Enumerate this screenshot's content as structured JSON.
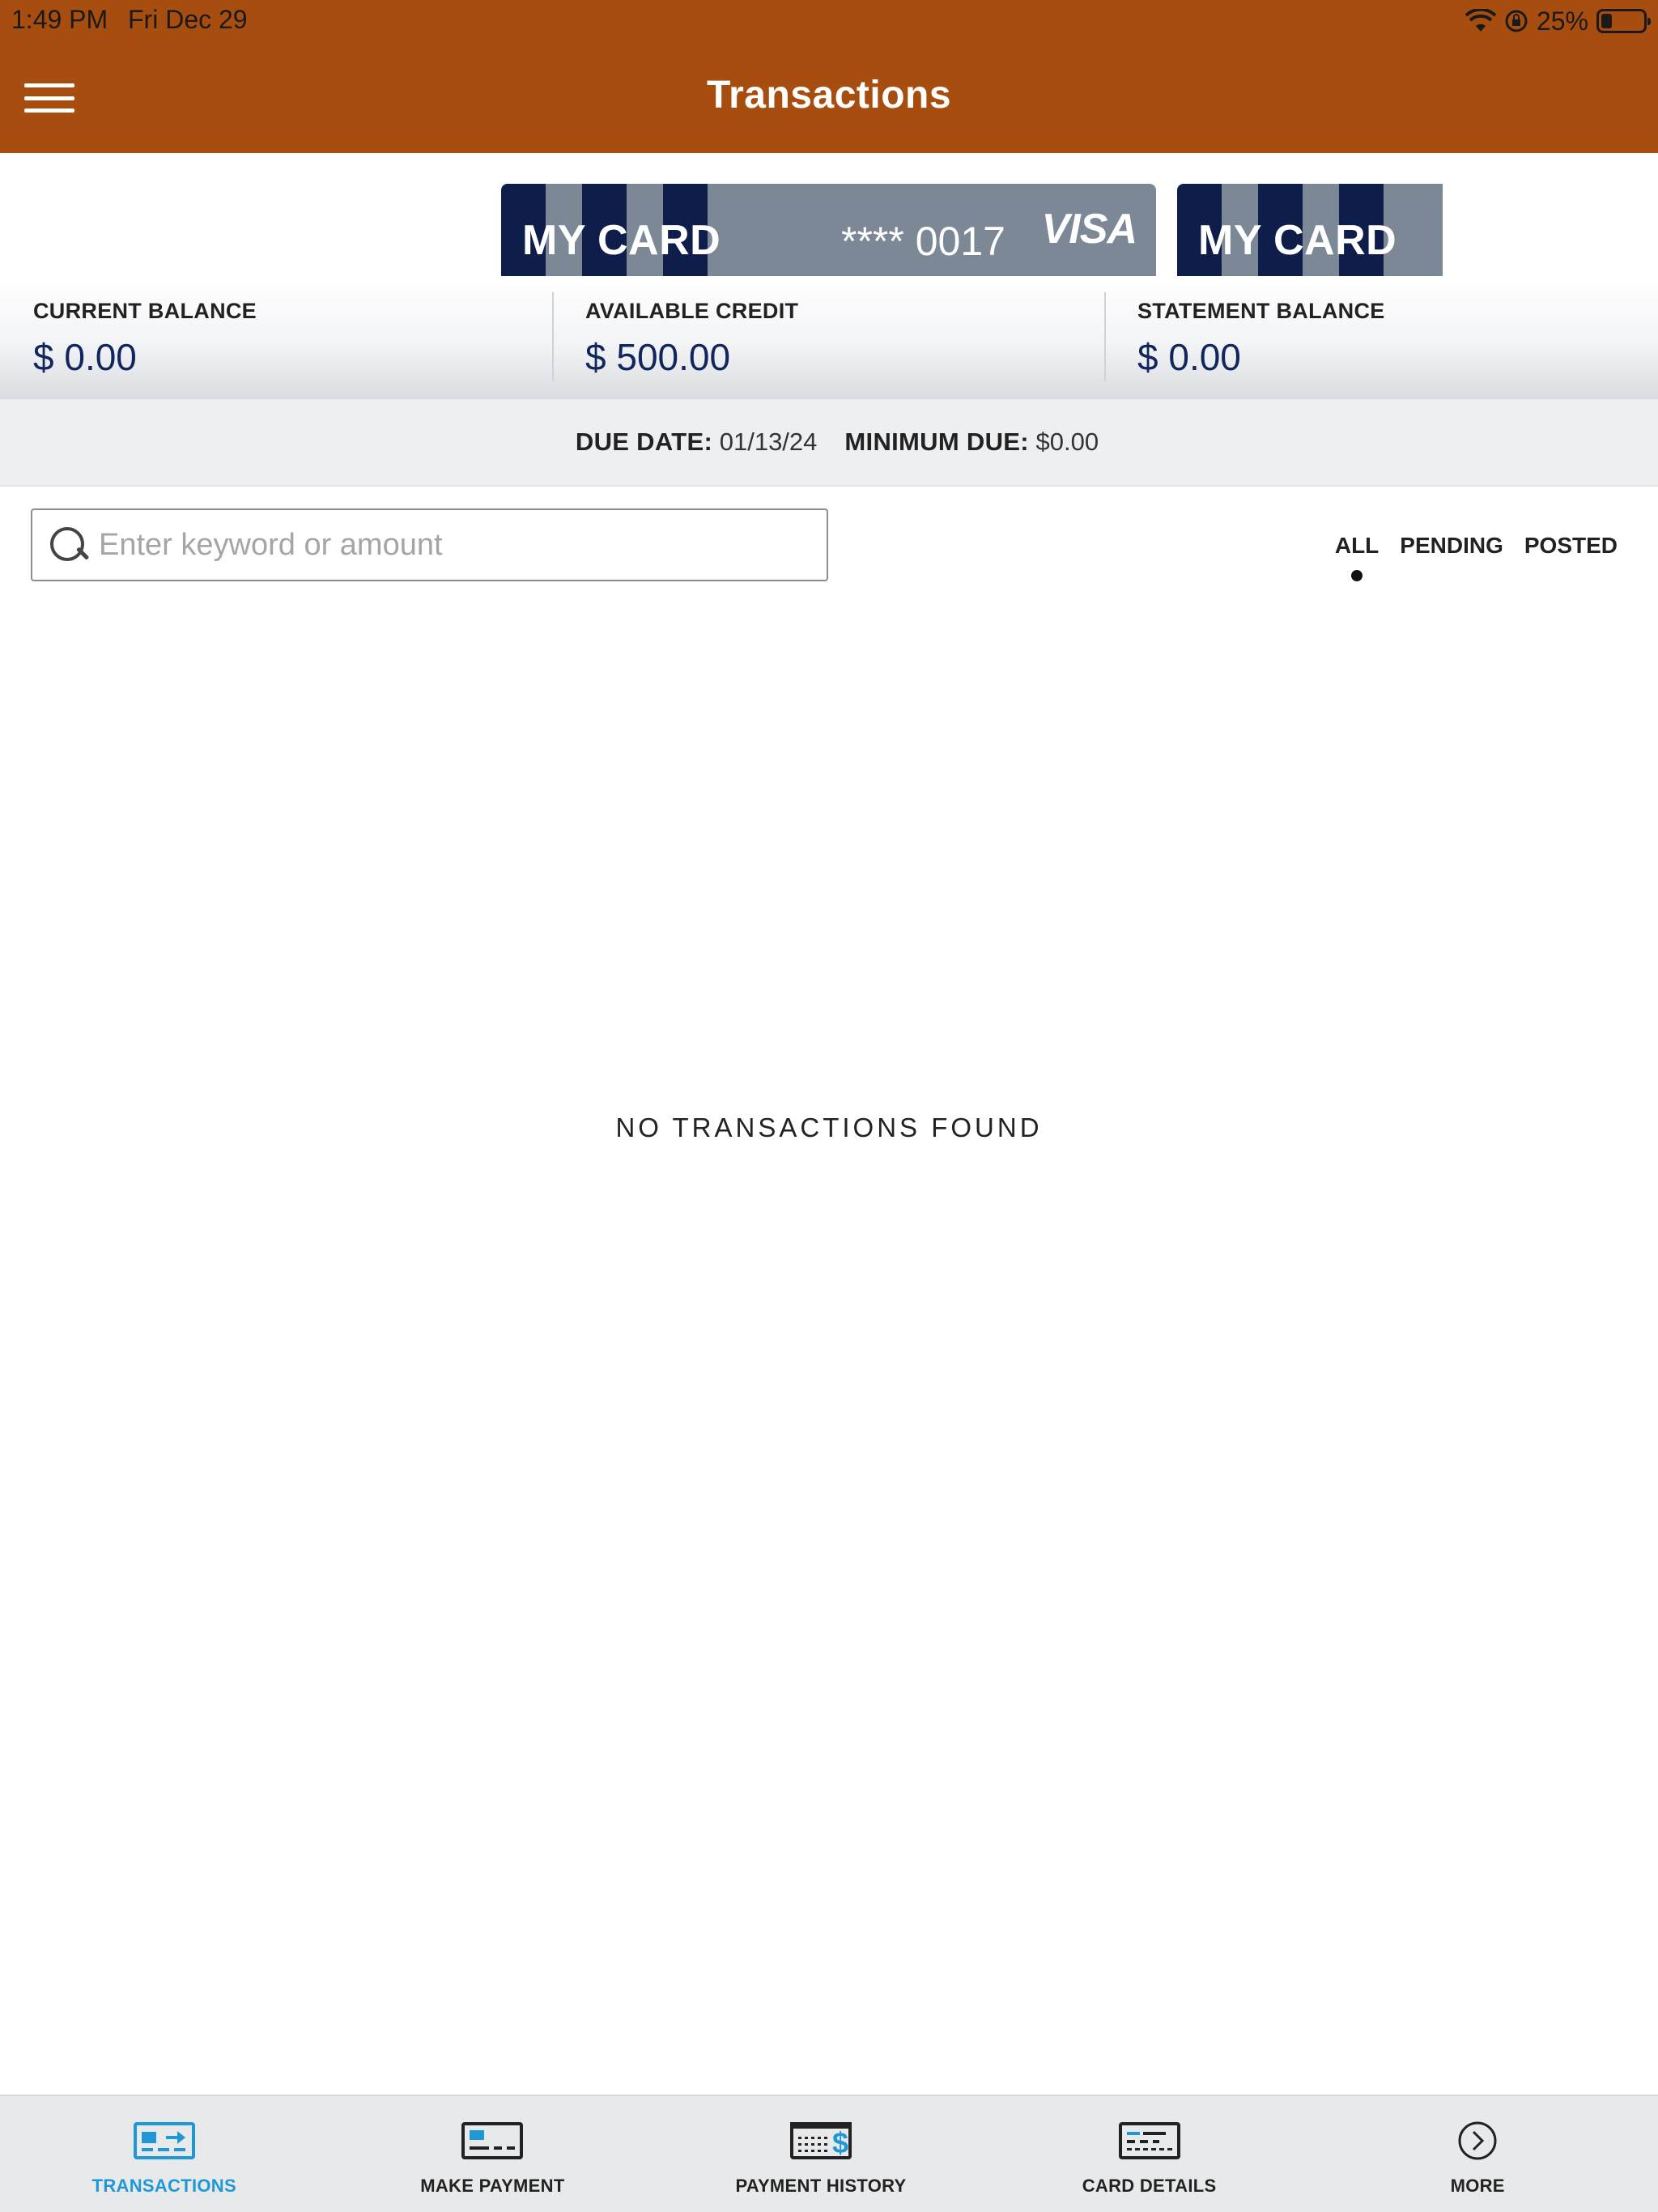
{
  "status_bar": {
    "time": "1:49 PM",
    "date": "Fri Dec 29",
    "battery": "25%",
    "battery_level": 0.25
  },
  "header": {
    "title": "Transactions",
    "menu_icon": "hamburger-menu-icon"
  },
  "cards": [
    {
      "name": "MY CARD",
      "number": "**** 0017",
      "brand": "VISA"
    },
    {
      "name": "MY CARD"
    }
  ],
  "balances": {
    "current_label": "CURRENT BALANCE",
    "current_value": "$ 0.00",
    "available_label": "AVAILABLE CREDIT",
    "available_value": "$ 500.00",
    "statement_label": "STATEMENT BALANCE",
    "statement_value": "$ 0.00"
  },
  "due": {
    "due_date_label": "DUE DATE:",
    "due_date_value": "01/13/24",
    "minimum_due_label": "MINIMUM DUE:",
    "minimum_due_value": "$0.00"
  },
  "search": {
    "placeholder": "Enter keyword or amount",
    "value": ""
  },
  "filters": {
    "items": [
      "ALL",
      "PENDING",
      "POSTED"
    ],
    "selected": "ALL"
  },
  "empty_state": "NO TRANSACTIONS FOUND",
  "tabbar": {
    "items": [
      {
        "label": "TRANSACTIONS",
        "icon": "transactions-icon",
        "active": true
      },
      {
        "label": "MAKE PAYMENT",
        "icon": "make-payment-icon",
        "active": false
      },
      {
        "label": "PAYMENT HISTORY",
        "icon": "payment-history-icon",
        "active": false
      },
      {
        "label": "CARD DETAILS",
        "icon": "card-details-icon",
        "active": false
      },
      {
        "label": "MORE",
        "icon": "more-icon",
        "active": false
      }
    ]
  },
  "colors": {
    "header_bg": "#a84d10",
    "card_gray": "#7d8896",
    "card_navy": "#0e1d4a",
    "balance_text": "#10265c",
    "active_tab": "#1f98d6"
  }
}
